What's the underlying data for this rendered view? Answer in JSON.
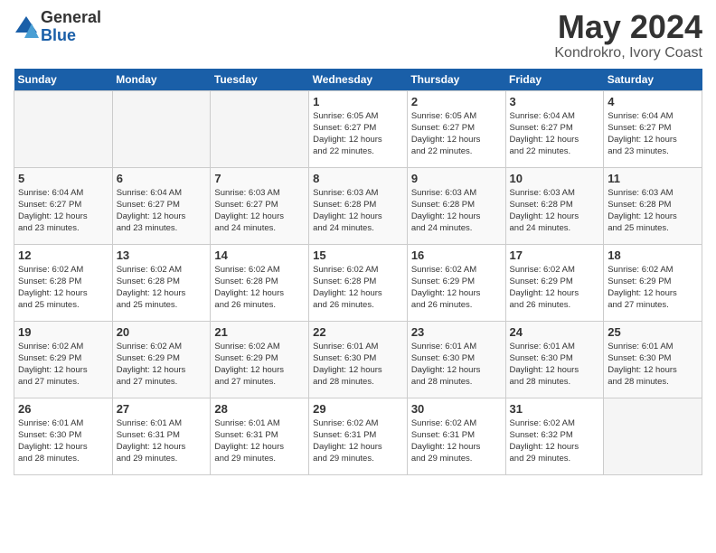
{
  "logo": {
    "general": "General",
    "blue": "Blue"
  },
  "title": "May 2024",
  "subtitle": "Kondrokro, Ivory Coast",
  "days_of_week": [
    "Sunday",
    "Monday",
    "Tuesday",
    "Wednesday",
    "Thursday",
    "Friday",
    "Saturday"
  ],
  "weeks": [
    [
      {
        "day": "",
        "info": ""
      },
      {
        "day": "",
        "info": ""
      },
      {
        "day": "",
        "info": ""
      },
      {
        "day": "1",
        "info": "Sunrise: 6:05 AM\nSunset: 6:27 PM\nDaylight: 12 hours\nand 22 minutes."
      },
      {
        "day": "2",
        "info": "Sunrise: 6:05 AM\nSunset: 6:27 PM\nDaylight: 12 hours\nand 22 minutes."
      },
      {
        "day": "3",
        "info": "Sunrise: 6:04 AM\nSunset: 6:27 PM\nDaylight: 12 hours\nand 22 minutes."
      },
      {
        "day": "4",
        "info": "Sunrise: 6:04 AM\nSunset: 6:27 PM\nDaylight: 12 hours\nand 23 minutes."
      }
    ],
    [
      {
        "day": "5",
        "info": "Sunrise: 6:04 AM\nSunset: 6:27 PM\nDaylight: 12 hours\nand 23 minutes."
      },
      {
        "day": "6",
        "info": "Sunrise: 6:04 AM\nSunset: 6:27 PM\nDaylight: 12 hours\nand 23 minutes."
      },
      {
        "day": "7",
        "info": "Sunrise: 6:03 AM\nSunset: 6:27 PM\nDaylight: 12 hours\nand 24 minutes."
      },
      {
        "day": "8",
        "info": "Sunrise: 6:03 AM\nSunset: 6:28 PM\nDaylight: 12 hours\nand 24 minutes."
      },
      {
        "day": "9",
        "info": "Sunrise: 6:03 AM\nSunset: 6:28 PM\nDaylight: 12 hours\nand 24 minutes."
      },
      {
        "day": "10",
        "info": "Sunrise: 6:03 AM\nSunset: 6:28 PM\nDaylight: 12 hours\nand 24 minutes."
      },
      {
        "day": "11",
        "info": "Sunrise: 6:03 AM\nSunset: 6:28 PM\nDaylight: 12 hours\nand 25 minutes."
      }
    ],
    [
      {
        "day": "12",
        "info": "Sunrise: 6:02 AM\nSunset: 6:28 PM\nDaylight: 12 hours\nand 25 minutes."
      },
      {
        "day": "13",
        "info": "Sunrise: 6:02 AM\nSunset: 6:28 PM\nDaylight: 12 hours\nand 25 minutes."
      },
      {
        "day": "14",
        "info": "Sunrise: 6:02 AM\nSunset: 6:28 PM\nDaylight: 12 hours\nand 26 minutes."
      },
      {
        "day": "15",
        "info": "Sunrise: 6:02 AM\nSunset: 6:28 PM\nDaylight: 12 hours\nand 26 minutes."
      },
      {
        "day": "16",
        "info": "Sunrise: 6:02 AM\nSunset: 6:29 PM\nDaylight: 12 hours\nand 26 minutes."
      },
      {
        "day": "17",
        "info": "Sunrise: 6:02 AM\nSunset: 6:29 PM\nDaylight: 12 hours\nand 26 minutes."
      },
      {
        "day": "18",
        "info": "Sunrise: 6:02 AM\nSunset: 6:29 PM\nDaylight: 12 hours\nand 27 minutes."
      }
    ],
    [
      {
        "day": "19",
        "info": "Sunrise: 6:02 AM\nSunset: 6:29 PM\nDaylight: 12 hours\nand 27 minutes."
      },
      {
        "day": "20",
        "info": "Sunrise: 6:02 AM\nSunset: 6:29 PM\nDaylight: 12 hours\nand 27 minutes."
      },
      {
        "day": "21",
        "info": "Sunrise: 6:02 AM\nSunset: 6:29 PM\nDaylight: 12 hours\nand 27 minutes."
      },
      {
        "day": "22",
        "info": "Sunrise: 6:01 AM\nSunset: 6:30 PM\nDaylight: 12 hours\nand 28 minutes."
      },
      {
        "day": "23",
        "info": "Sunrise: 6:01 AM\nSunset: 6:30 PM\nDaylight: 12 hours\nand 28 minutes."
      },
      {
        "day": "24",
        "info": "Sunrise: 6:01 AM\nSunset: 6:30 PM\nDaylight: 12 hours\nand 28 minutes."
      },
      {
        "day": "25",
        "info": "Sunrise: 6:01 AM\nSunset: 6:30 PM\nDaylight: 12 hours\nand 28 minutes."
      }
    ],
    [
      {
        "day": "26",
        "info": "Sunrise: 6:01 AM\nSunset: 6:30 PM\nDaylight: 12 hours\nand 28 minutes."
      },
      {
        "day": "27",
        "info": "Sunrise: 6:01 AM\nSunset: 6:31 PM\nDaylight: 12 hours\nand 29 minutes."
      },
      {
        "day": "28",
        "info": "Sunrise: 6:01 AM\nSunset: 6:31 PM\nDaylight: 12 hours\nand 29 minutes."
      },
      {
        "day": "29",
        "info": "Sunrise: 6:02 AM\nSunset: 6:31 PM\nDaylight: 12 hours\nand 29 minutes."
      },
      {
        "day": "30",
        "info": "Sunrise: 6:02 AM\nSunset: 6:31 PM\nDaylight: 12 hours\nand 29 minutes."
      },
      {
        "day": "31",
        "info": "Sunrise: 6:02 AM\nSunset: 6:32 PM\nDaylight: 12 hours\nand 29 minutes."
      },
      {
        "day": "",
        "info": ""
      }
    ]
  ]
}
